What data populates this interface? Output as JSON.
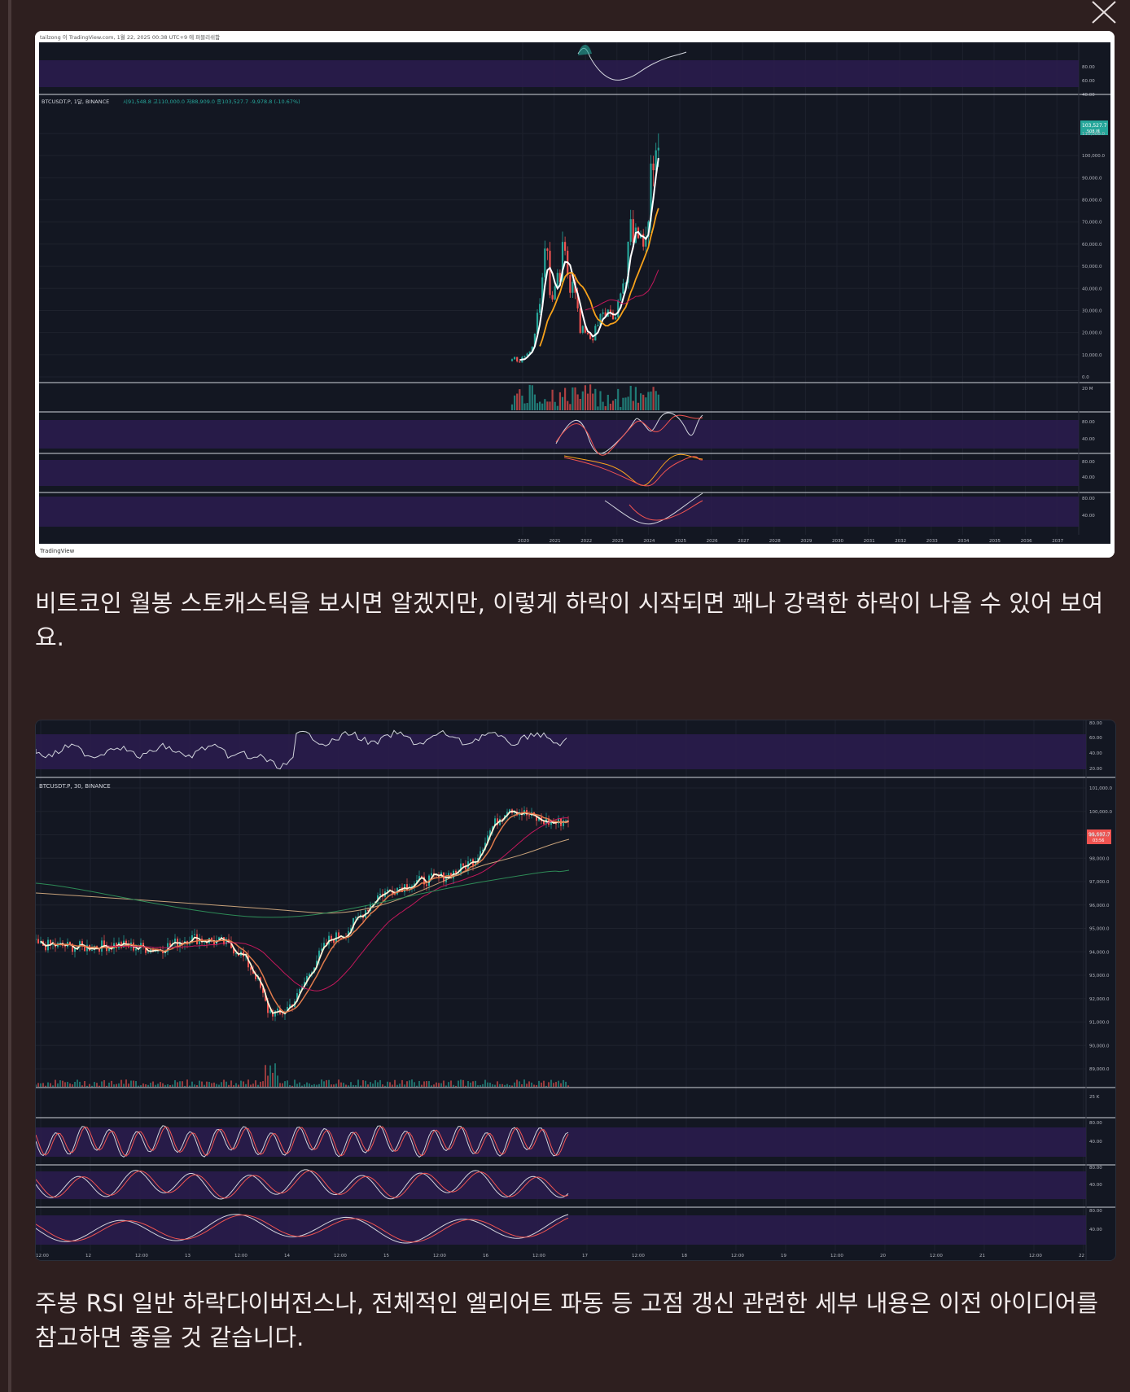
{
  "paragraphs": {
    "p1": "비트코인 월봉 스토캐스틱을 보시면 알겠지만, 이렇게 하락이 시작되면 꽤나 강력한 하락이 나올 수 있어 보여요.",
    "p2": "주봉 RSI 일반 하락다이버전스나, 전체적인 엘리어트 파동 등 고점 갱신 관련한 세부 내용은 이전 아이디어를 참고하면 좋을 것 같습니다."
  },
  "chart1": {
    "header_text": "tailzong 이 TradingView.com, 1월 22, 2025 00:38 UTC+9 에 퍼블리쉬함",
    "symbol_line": "BTCUSDT.P, 1달, BINANCE",
    "ohlc": "시91,548.8  고110,000.0  저88,909.0  종103,527.7  -9,978.8 (-10.67%)",
    "price_label": "103,527.7",
    "price_sub": "508 에",
    "footer": "TradingView",
    "y_ticks": [
      "110,000.0",
      "100,000.0",
      "90,000.0",
      "80,000.0",
      "70,000.0",
      "60,000.0",
      "50,000.0",
      "40,000.0",
      "30,000.0",
      "20,000.0",
      "10,000.0",
      "0.0"
    ],
    "volume_tick": "20 M",
    "osc_ticks": [
      "80.00",
      "60.00",
      "40.00"
    ],
    "x_ticks": [
      "2020",
      "2021",
      "2022",
      "2023",
      "2024",
      "2025",
      "2026",
      "2027",
      "2028",
      "2029",
      "2030",
      "2031",
      "2032",
      "2033",
      "2034",
      "2035",
      "2036",
      "2037"
    ],
    "colors": {
      "up": "#26a69a",
      "down": "#ef5350",
      "ma_fast": "#ffffff",
      "ma_slow": "#f7a21b",
      "band": "#2b1c4f"
    }
  },
  "chart2": {
    "symbol_line": "BTCUSDT.P, 30, BINANCE",
    "price_label": "99,697.7",
    "price_sub": "03:56",
    "y_ticks": [
      "101,000.0",
      "100,000.0",
      "99,000.0",
      "98,000.0",
      "97,000.0",
      "96,000.0",
      "95,000.0",
      "94,000.0",
      "93,000.0",
      "92,000.0",
      "91,000.0",
      "90,000.0",
      "89,000.0"
    ],
    "volume_tick": "25 K",
    "rsi_ticks": [
      "80.00",
      "60.00",
      "40.00",
      "20.00"
    ],
    "osc_ticks": [
      "80.00",
      "40.00"
    ],
    "x_ticks": [
      "12:00",
      "12",
      "12:00",
      "13",
      "12:00",
      "14",
      "12:00",
      "15",
      "12:00",
      "16",
      "12:00",
      "17",
      "12:00",
      "18",
      "12:00",
      "19",
      "12:00",
      "20",
      "12:00",
      "21",
      "12:00",
      "22"
    ]
  }
}
